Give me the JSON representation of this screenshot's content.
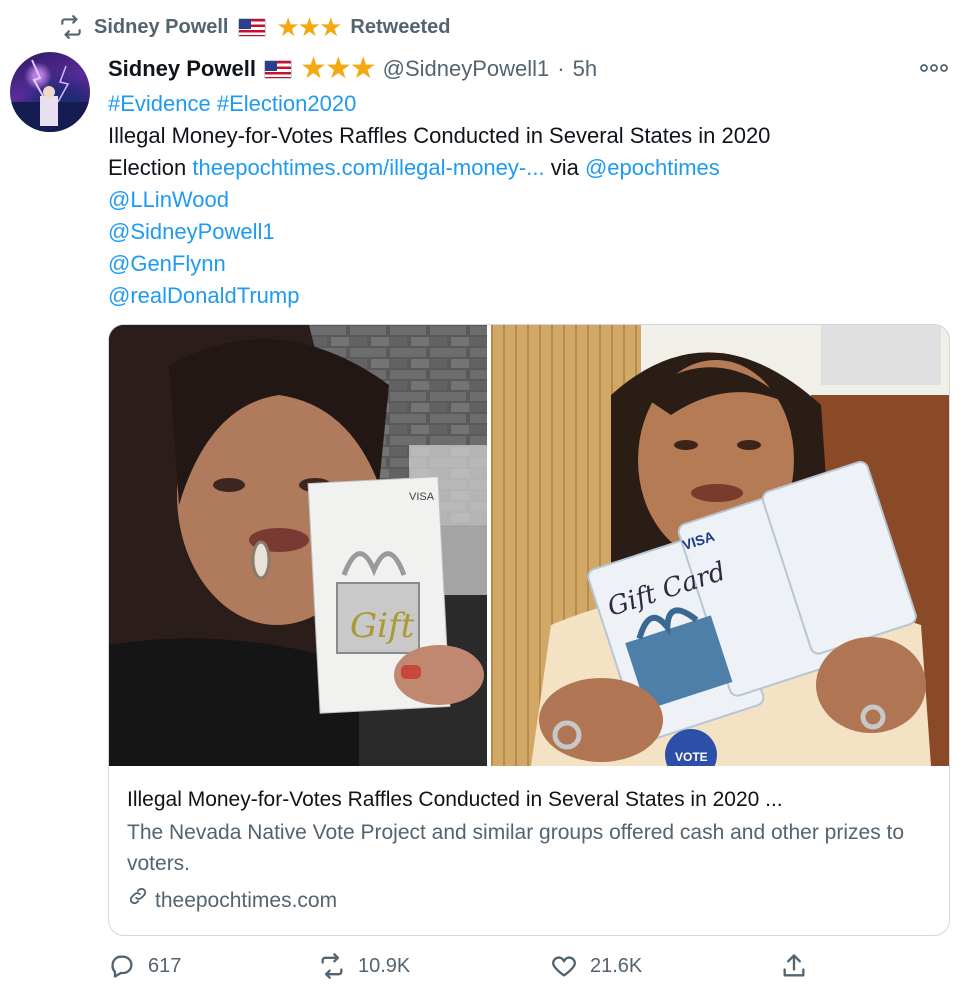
{
  "retweet_header": {
    "name": "Sidney Powell",
    "label": "Retweeted",
    "stars": "★★★"
  },
  "tweet": {
    "display_name": "Sidney Powell",
    "stars": "★★★",
    "handle": "@SidneyPowell1",
    "separator": "·",
    "time": "5h",
    "hashtags": [
      "#Evidence",
      "#Election2020"
    ],
    "text_line1": "Illegal Money-for-Votes Raffles Conducted in Several States in 2020",
    "text_line2_prefix": "Election",
    "url": "theepochtimes.com/illegal-money-...",
    "via": "via",
    "via_mention": "@epochtimes",
    "mentions": [
      "@LLinWood",
      "@SidneyPowell1",
      "@GenFlynn",
      "@realDonaldTrump"
    ]
  },
  "card": {
    "title": "Illegal Money-for-Votes Raffles Conducted in Several States in 2020 ...",
    "description": "The Nevada Native Vote Project and similar groups offered cash and other prizes to voters.",
    "domain": "theepochtimes.com",
    "left_image_text": "Gift",
    "right_image_text": "Gift Card",
    "visa_label": "VISA",
    "vote_badge": "VOTE"
  },
  "actions": {
    "replies": "617",
    "retweets": "10.9K",
    "likes": "21.6K"
  },
  "colors": {
    "accent": "#1d9bf0",
    "secondary_text": "#536471",
    "star": "#f4a812"
  }
}
